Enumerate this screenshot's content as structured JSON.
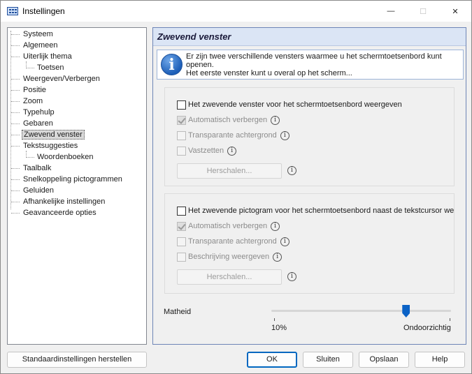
{
  "window": {
    "title": "Instellingen",
    "icon": "keyboard-icon",
    "controls": {
      "minimize": "—",
      "maximize": "☐",
      "close": "✕"
    }
  },
  "tree": {
    "items": [
      {
        "label": "Systeem",
        "level": 0
      },
      {
        "label": "Algemeen",
        "level": 0
      },
      {
        "label": "Uiterlijk thema",
        "level": 0
      },
      {
        "label": "Toetsen",
        "level": 1
      },
      {
        "label": "Weergeven/Verbergen",
        "level": 0
      },
      {
        "label": "Positie",
        "level": 0
      },
      {
        "label": "Zoom",
        "level": 0
      },
      {
        "label": "Typehulp",
        "level": 0
      },
      {
        "label": "Gebaren",
        "level": 0
      },
      {
        "label": "Zwevend venster",
        "level": 0,
        "selected": true
      },
      {
        "label": "Tekstsuggesties",
        "level": 0
      },
      {
        "label": "Woordenboeken",
        "level": 1
      },
      {
        "label": "Taalbalk",
        "level": 0
      },
      {
        "label": "Snelkoppeling pictogrammen",
        "level": 0
      },
      {
        "label": "Geluiden",
        "level": 0
      },
      {
        "label": "Afhankelijke instellingen",
        "level": 0
      },
      {
        "label": "Geavanceerde opties",
        "level": 0
      }
    ]
  },
  "panel": {
    "title": "Zwevend venster",
    "info_line1": "Er zijn twee verschillende vensters waarmee u het schermtoetsenbord kunt",
    "info_line2": "openen.",
    "info_line3": "Het eerste venster kunt u overal op het scherm...",
    "group1": {
      "main_checkbox": "Het zwevende venster voor het schermtoetsenbord weergeven",
      "auto_hide": "Automatisch verbergen",
      "transparent_bg": "Transparante achtergrond",
      "pin": "Vastzetten",
      "resize_button": "Herschalen..."
    },
    "group2": {
      "main_checkbox": "Het zwevende pictogram voor het schermtoetsenbord naast de tekstcursor weergeven",
      "auto_hide": "Automatisch verbergen",
      "transparent_bg": "Transparante achtergrond",
      "show_description": "Beschrijving weergeven",
      "resize_button": "Herschalen..."
    },
    "opacity": {
      "label": "Matheid",
      "min_label": "10%",
      "max_label": "Ondoorzichtig",
      "value_fraction": 0.75
    },
    "hint_glyph": "i"
  },
  "footer": {
    "reset": "Standaardinstellingen herstellen",
    "ok": "OK",
    "close": "Sluiten",
    "save": "Opslaan",
    "help": "Help"
  },
  "colors": {
    "accent": "#0067c0",
    "slider_thumb": "#0a62c6",
    "panel_header_bg": "#dbe5f5"
  }
}
